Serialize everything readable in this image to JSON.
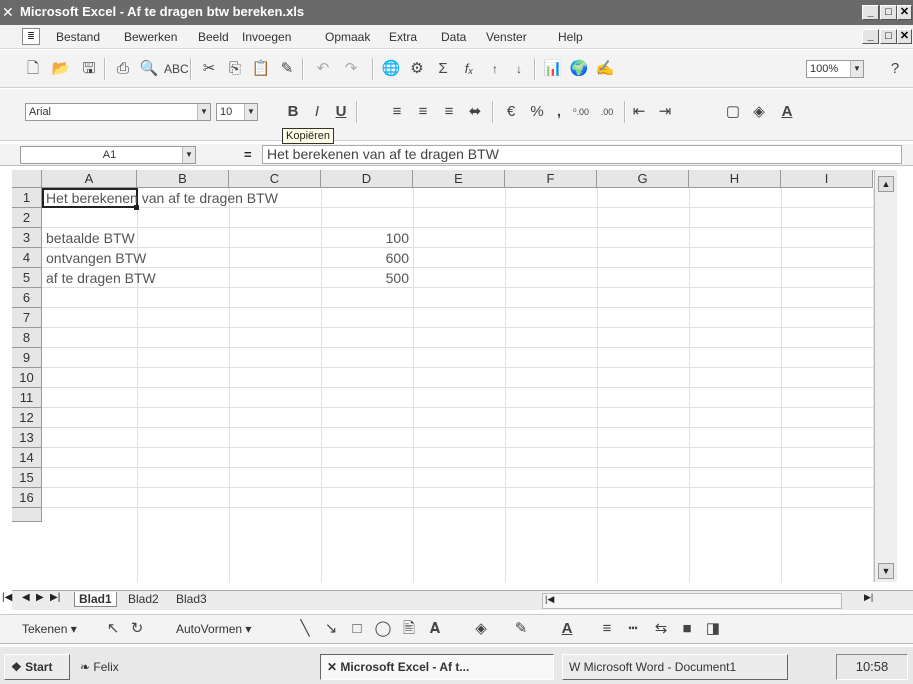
{
  "window": {
    "title": "Microsoft Excel - Af te dragen btw bereken.xls",
    "app_icon": "excel-icon",
    "controls": [
      "_",
      "̸",
      "x"
    ]
  },
  "menu": {
    "items": [
      "Bestand",
      "Bewerken",
      "Beeld",
      "Invoegen",
      "Opmaak",
      "Extra",
      "Data",
      "Venster",
      "Help"
    ]
  },
  "toolbar": {
    "zoom": "100%",
    "font_name": "Arial",
    "font_size": "10",
    "tooltip": "Kopiëren",
    "bold": "B",
    "italic": "I",
    "underline": "U",
    "percent": "%",
    "comma": ",",
    "inc_decimal": "⁰.00",
    "dec_decimal": ".00",
    "sum": "Σ",
    "fx": "fₓ"
  },
  "formula_bar": {
    "cell_ref": "A1",
    "equals": "=",
    "content": "Het berekenen van af te dragen BTW"
  },
  "grid": {
    "columns": [
      "A",
      "B",
      "C",
      "D",
      "E",
      "F",
      "G",
      "H",
      "I"
    ],
    "rows": [
      "1",
      "2",
      "3",
      "4",
      "5",
      "6",
      "7",
      "8",
      "9",
      "10",
      "11",
      "12",
      "13",
      "14",
      "15",
      "16"
    ],
    "cells": {
      "A1": "Het berekenen van af te dragen BTW",
      "A3": "betaalde BTW",
      "D3": "100",
      "A4": "ontvangen BTW",
      "D4": "600",
      "A5": "af te dragen BTW",
      "D5": "500"
    }
  },
  "sheets": {
    "tabs": [
      "Blad1",
      "Blad2",
      "Blad3"
    ],
    "active": "Blad1"
  },
  "drawing": {
    "draw_label": "Tekenen",
    "autoshapes_label": "AutoVormen"
  },
  "taskbar": {
    "start_label": "Start",
    "quicklaunch_label": "Felix",
    "task1": "Microsoft Excel - Af t...",
    "task2": "Microsoft Word - Document1",
    "clock": "10:58"
  }
}
